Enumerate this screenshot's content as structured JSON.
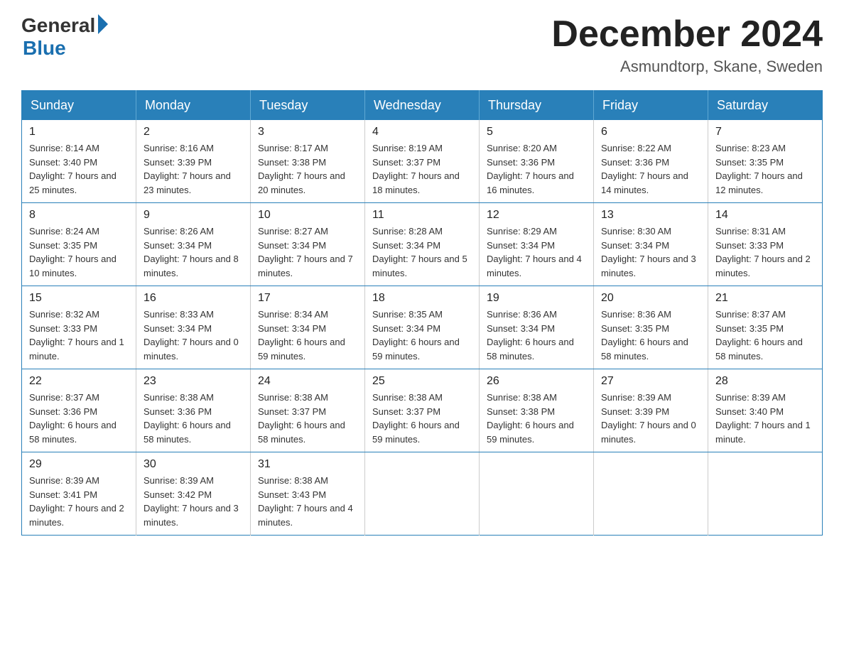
{
  "logo": {
    "general": "General",
    "blue": "Blue"
  },
  "header": {
    "month": "December 2024",
    "location": "Asmundtorp, Skane, Sweden"
  },
  "weekdays": [
    "Sunday",
    "Monday",
    "Tuesday",
    "Wednesday",
    "Thursday",
    "Friday",
    "Saturday"
  ],
  "weeks": [
    [
      {
        "day": "1",
        "sunrise": "8:14 AM",
        "sunset": "3:40 PM",
        "daylight": "7 hours and 25 minutes."
      },
      {
        "day": "2",
        "sunrise": "8:16 AM",
        "sunset": "3:39 PM",
        "daylight": "7 hours and 23 minutes."
      },
      {
        "day": "3",
        "sunrise": "8:17 AM",
        "sunset": "3:38 PM",
        "daylight": "7 hours and 20 minutes."
      },
      {
        "day": "4",
        "sunrise": "8:19 AM",
        "sunset": "3:37 PM",
        "daylight": "7 hours and 18 minutes."
      },
      {
        "day": "5",
        "sunrise": "8:20 AM",
        "sunset": "3:36 PM",
        "daylight": "7 hours and 16 minutes."
      },
      {
        "day": "6",
        "sunrise": "8:22 AM",
        "sunset": "3:36 PM",
        "daylight": "7 hours and 14 minutes."
      },
      {
        "day": "7",
        "sunrise": "8:23 AM",
        "sunset": "3:35 PM",
        "daylight": "7 hours and 12 minutes."
      }
    ],
    [
      {
        "day": "8",
        "sunrise": "8:24 AM",
        "sunset": "3:35 PM",
        "daylight": "7 hours and 10 minutes."
      },
      {
        "day": "9",
        "sunrise": "8:26 AM",
        "sunset": "3:34 PM",
        "daylight": "7 hours and 8 minutes."
      },
      {
        "day": "10",
        "sunrise": "8:27 AM",
        "sunset": "3:34 PM",
        "daylight": "7 hours and 7 minutes."
      },
      {
        "day": "11",
        "sunrise": "8:28 AM",
        "sunset": "3:34 PM",
        "daylight": "7 hours and 5 minutes."
      },
      {
        "day": "12",
        "sunrise": "8:29 AM",
        "sunset": "3:34 PM",
        "daylight": "7 hours and 4 minutes."
      },
      {
        "day": "13",
        "sunrise": "8:30 AM",
        "sunset": "3:34 PM",
        "daylight": "7 hours and 3 minutes."
      },
      {
        "day": "14",
        "sunrise": "8:31 AM",
        "sunset": "3:33 PM",
        "daylight": "7 hours and 2 minutes."
      }
    ],
    [
      {
        "day": "15",
        "sunrise": "8:32 AM",
        "sunset": "3:33 PM",
        "daylight": "7 hours and 1 minute."
      },
      {
        "day": "16",
        "sunrise": "8:33 AM",
        "sunset": "3:34 PM",
        "daylight": "7 hours and 0 minutes."
      },
      {
        "day": "17",
        "sunrise": "8:34 AM",
        "sunset": "3:34 PM",
        "daylight": "6 hours and 59 minutes."
      },
      {
        "day": "18",
        "sunrise": "8:35 AM",
        "sunset": "3:34 PM",
        "daylight": "6 hours and 59 minutes."
      },
      {
        "day": "19",
        "sunrise": "8:36 AM",
        "sunset": "3:34 PM",
        "daylight": "6 hours and 58 minutes."
      },
      {
        "day": "20",
        "sunrise": "8:36 AM",
        "sunset": "3:35 PM",
        "daylight": "6 hours and 58 minutes."
      },
      {
        "day": "21",
        "sunrise": "8:37 AM",
        "sunset": "3:35 PM",
        "daylight": "6 hours and 58 minutes."
      }
    ],
    [
      {
        "day": "22",
        "sunrise": "8:37 AM",
        "sunset": "3:36 PM",
        "daylight": "6 hours and 58 minutes."
      },
      {
        "day": "23",
        "sunrise": "8:38 AM",
        "sunset": "3:36 PM",
        "daylight": "6 hours and 58 minutes."
      },
      {
        "day": "24",
        "sunrise": "8:38 AM",
        "sunset": "3:37 PM",
        "daylight": "6 hours and 58 minutes."
      },
      {
        "day": "25",
        "sunrise": "8:38 AM",
        "sunset": "3:37 PM",
        "daylight": "6 hours and 59 minutes."
      },
      {
        "day": "26",
        "sunrise": "8:38 AM",
        "sunset": "3:38 PM",
        "daylight": "6 hours and 59 minutes."
      },
      {
        "day": "27",
        "sunrise": "8:39 AM",
        "sunset": "3:39 PM",
        "daylight": "7 hours and 0 minutes."
      },
      {
        "day": "28",
        "sunrise": "8:39 AM",
        "sunset": "3:40 PM",
        "daylight": "7 hours and 1 minute."
      }
    ],
    [
      {
        "day": "29",
        "sunrise": "8:39 AM",
        "sunset": "3:41 PM",
        "daylight": "7 hours and 2 minutes."
      },
      {
        "day": "30",
        "sunrise": "8:39 AM",
        "sunset": "3:42 PM",
        "daylight": "7 hours and 3 minutes."
      },
      {
        "day": "31",
        "sunrise": "8:38 AM",
        "sunset": "3:43 PM",
        "daylight": "7 hours and 4 minutes."
      },
      null,
      null,
      null,
      null
    ]
  ]
}
